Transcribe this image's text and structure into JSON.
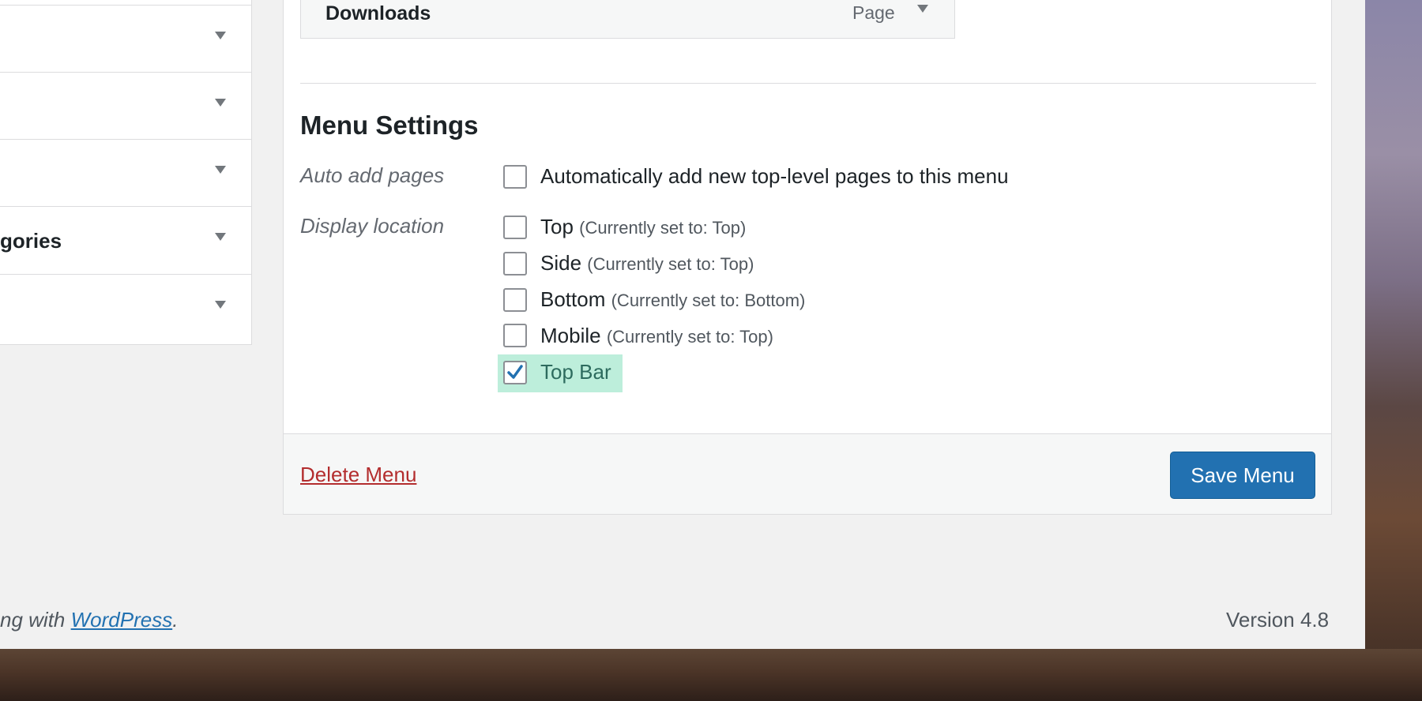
{
  "menu_items": {
    "downloads": {
      "title": "Downloads",
      "type": "Page"
    }
  },
  "accordion": {
    "items": [
      {
        "label": ""
      },
      {
        "label": ""
      },
      {
        "label": ""
      },
      {
        "label": "gories"
      },
      {
        "label": ""
      }
    ]
  },
  "menu_settings": {
    "heading": "Menu Settings",
    "auto_add": {
      "label": "Auto add pages",
      "option": "Automatically add new top-level pages to this menu",
      "checked": false
    },
    "display_location": {
      "label": "Display location",
      "options": [
        {
          "name": "Top",
          "note": "(Currently set to: Top)",
          "checked": false
        },
        {
          "name": "Side",
          "note": "(Currently set to: Top)",
          "checked": false
        },
        {
          "name": "Bottom",
          "note": "(Currently set to: Bottom)",
          "checked": false
        },
        {
          "name": "Mobile",
          "note": "(Currently set to: Top)",
          "checked": false
        },
        {
          "name": "Top Bar",
          "note": "",
          "checked": true
        }
      ]
    }
  },
  "actions": {
    "delete": "Delete Menu",
    "save": "Save Menu"
  },
  "footer": {
    "thanks_prefix": "ng with ",
    "wordpress_link": "WordPress",
    "thanks_suffix": ".",
    "version": "Version 4.8"
  },
  "colors": {
    "accent": "#2271b1",
    "danger": "#b32d2e",
    "highlight": "#bdeedb",
    "check": "#2271b1"
  },
  "icons": {
    "accordion_toggle": "triangle-down-icon",
    "checkmark": "checkmark-icon"
  }
}
